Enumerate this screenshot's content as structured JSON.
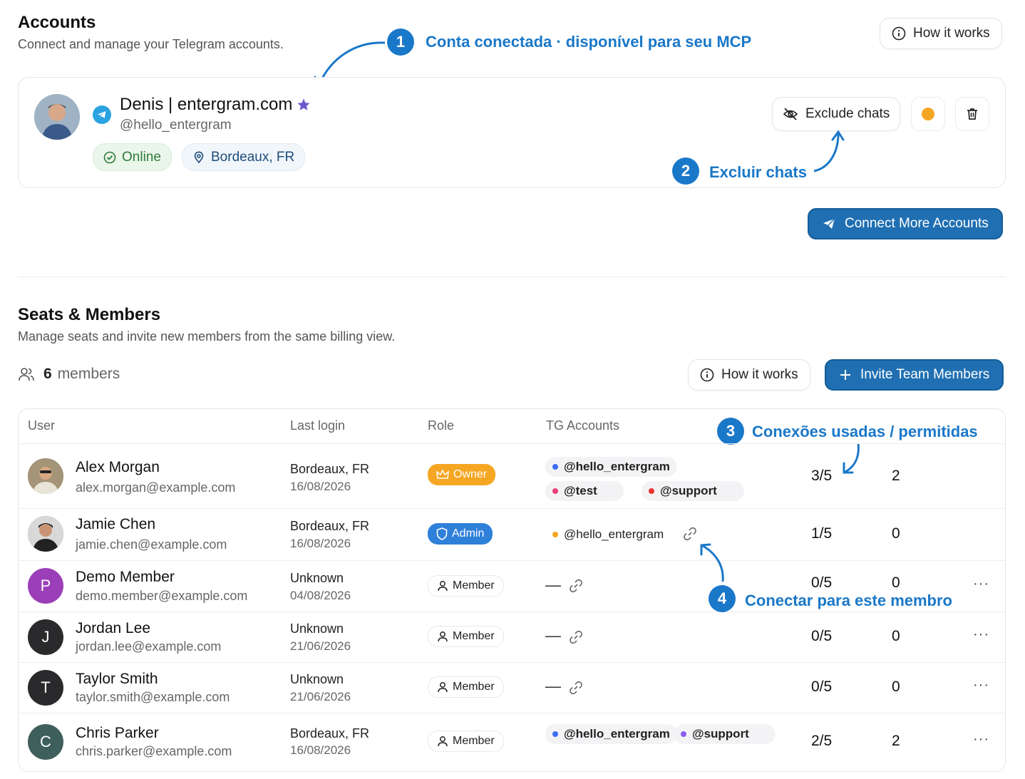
{
  "accounts": {
    "title": "Accounts",
    "subtitle": "Connect and manage your Telegram accounts.",
    "how_it_works": "How it works",
    "account": {
      "name": "Denis | entergram.com",
      "handle": "@hello_entergram",
      "status": "Online",
      "location": "Bordeaux, FR",
      "exclude_label": "Exclude chats",
      "status_color": "#f5a623"
    },
    "connect_more": "Connect More Accounts"
  },
  "annotations": {
    "a1": {
      "num": "1",
      "text": "Conta conectada · disponível para seu MCP"
    },
    "a2": {
      "num": "2",
      "text": "Excluir chats"
    },
    "a3": {
      "num": "3",
      "text": "Conexões usadas / permitidas"
    },
    "a4": {
      "num": "4",
      "text": "Conectar para este membro"
    }
  },
  "seats": {
    "title": "Seats & Members",
    "subtitle": "Manage seats and invite new members from the same billing view.",
    "count": "6",
    "count_label": "members",
    "how_it_works": "How it works",
    "invite": "Invite Team Members",
    "columns": [
      "User",
      "Last login",
      "Role",
      "TG Accounts"
    ],
    "rows": [
      {
        "name": "Alex Morgan",
        "email": "alex.morgan@example.com",
        "location": "Bordeaux, FR",
        "date": "16/08/2026",
        "role": "Owner",
        "tg": [
          "@hello_entergram",
          "@test",
          "@support"
        ],
        "used": "3/5",
        "count": "2"
      },
      {
        "name": "Jamie Chen",
        "email": "jamie.chen@example.com",
        "location": "Bordeaux, FR",
        "date": "16/08/2026",
        "role": "Admin",
        "tg": [
          "@hello_entergram"
        ],
        "used": "1/5",
        "count": "0"
      },
      {
        "name": "Demo Member",
        "initial": "P",
        "email": "demo.member@example.com",
        "location": "Unknown",
        "date": "04/08/2026",
        "role": "Member",
        "tg": [],
        "dash": "—",
        "used": "0/5",
        "count": "0"
      },
      {
        "name": "Jordan Lee",
        "initial": "J",
        "email": "jordan.lee@example.com",
        "location": "Unknown",
        "date": "21/06/2026",
        "role": "Member",
        "tg": [],
        "dash": "—",
        "used": "0/5",
        "count": "0"
      },
      {
        "name": "Taylor Smith",
        "initial": "T",
        "email": "taylor.smith@example.com",
        "location": "Unknown",
        "date": "21/06/2026",
        "role": "Member",
        "tg": [],
        "dash": "—",
        "used": "0/5",
        "count": "0"
      },
      {
        "name": "Chris Parker",
        "initial": "C",
        "email": "chris.parker@example.com",
        "location": "Bordeaux, FR",
        "date": "16/08/2026",
        "role": "Member",
        "tg": [
          "@hello_entergram",
          "@support"
        ],
        "used": "2/5",
        "count": "2"
      }
    ],
    "more": "···"
  },
  "colors": {
    "primary": "#1f6fb2",
    "annotation": "#1a78c9",
    "owner": "#f5a623",
    "admin": "#2f80d9"
  }
}
